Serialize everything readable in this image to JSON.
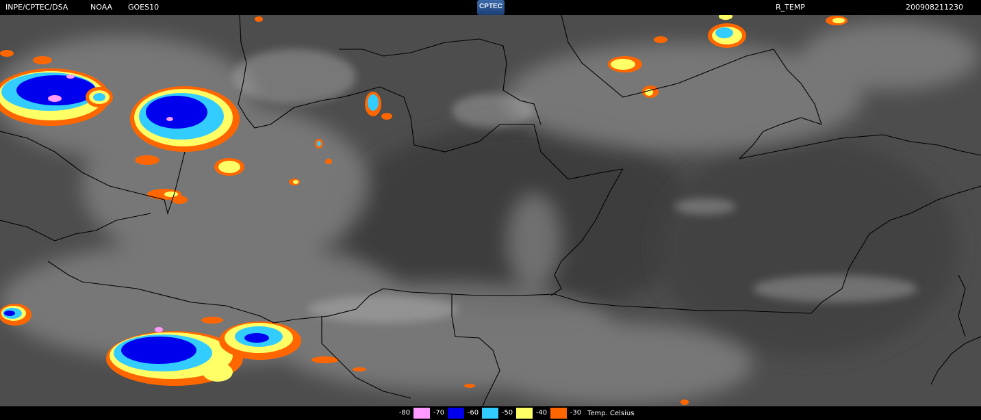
{
  "header": {
    "source": "INPE/CPTEC/DSA",
    "agency": "NOAA",
    "satellite": "GOES10",
    "logo_text": "CPTEC",
    "product": "R_TEMP",
    "timestamp": "200908211230"
  },
  "legend": {
    "items": [
      {
        "label": "-80",
        "color": "#ff99ff"
      },
      {
        "label": "-70",
        "color": "#0000ee"
      },
      {
        "label": "-60",
        "color": "#33ccff"
      },
      {
        "label": "-50",
        "color": "#ffff66"
      },
      {
        "label": "-40",
        "color": "#ff6600"
      },
      {
        "label": "-30",
        "color": ""
      }
    ],
    "unit": "Temp. Celsius"
  },
  "colors": {
    "background_gray": "#4a4a4a",
    "borders": "#000000"
  }
}
